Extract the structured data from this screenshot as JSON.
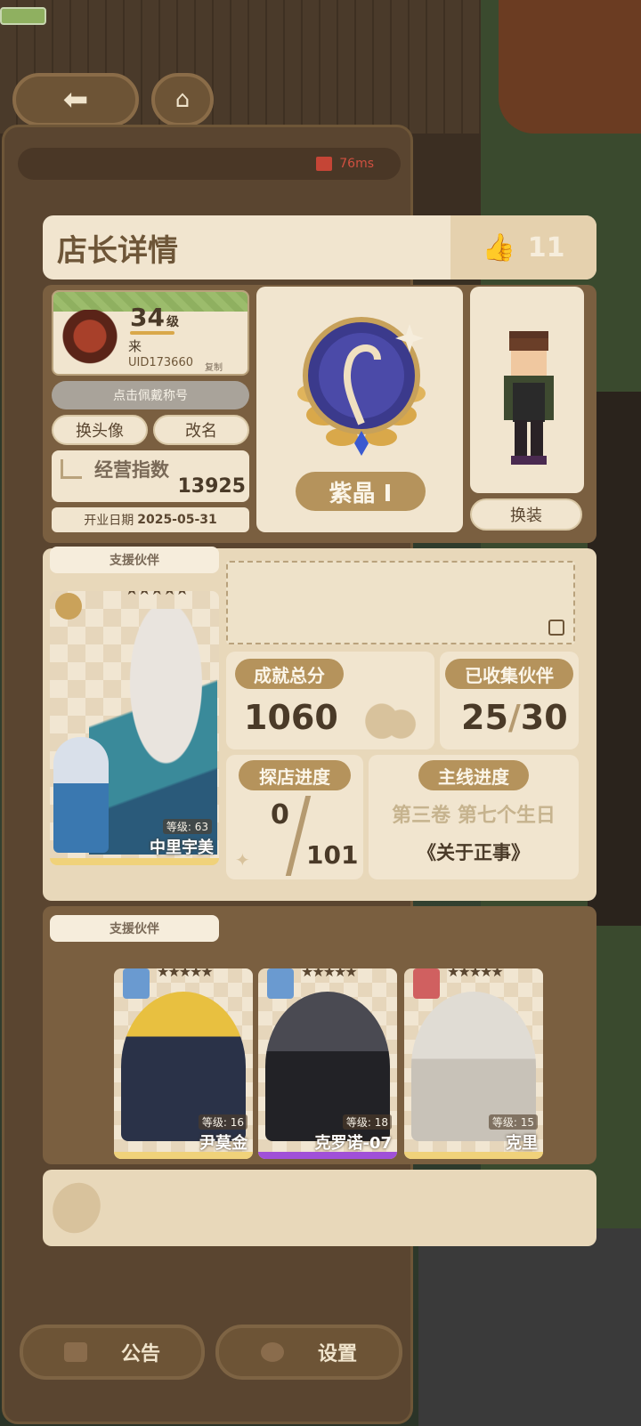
{
  "nav": {
    "back_icon": "left-arrow-icon",
    "home_icon": "home-icon"
  },
  "network": {
    "ping": "76ms",
    "color": "#d05040"
  },
  "modal": {
    "title": "店长详情",
    "likes": "11",
    "profile": {
      "level": "34",
      "level_suffix": "级",
      "name": "来",
      "uid": "UID173660",
      "copy_label": "复制",
      "wear_title_button": "点击佩戴称号",
      "change_avatar_button": "换头像",
      "rename_button": "改名",
      "business_label": "经营指数",
      "business_value": "13925",
      "open_date_label": "开业日期",
      "open_date_value": "2025-05-31"
    },
    "rank": {
      "name": "紫晶 Ⅰ"
    },
    "outfit": {
      "change_button": "换装"
    },
    "support": {
      "label": "支援伙伴",
      "main_partner": {
        "level": "等级: 63",
        "name": "中里宇美",
        "stars": "★★★★★"
      }
    },
    "stats": {
      "achievement_label": "成就总分",
      "achievement_value": "1060",
      "collected_label": "已收集伙伴",
      "collected_value": "25",
      "collected_total": "30",
      "visit_label": "探店进度",
      "visit_value": "0",
      "visit_total": "101",
      "main_label": "主线进度",
      "main_chapter": "第三卷 第七个生日",
      "main_title": "《关于正事》"
    },
    "support2": {
      "label": "支援伙伴",
      "partners": [
        {
          "level": "等级: 16",
          "name": "尹莫金",
          "stars": "★★★★★"
        },
        {
          "level": "等级: 18",
          "name": "克罗诺-07",
          "stars": "★★★★★"
        },
        {
          "level": "等级: 15",
          "name": "克里",
          "stars": "★★★★★"
        }
      ]
    }
  },
  "bottom": {
    "notice_label": "公告",
    "settings_label": "设置"
  }
}
